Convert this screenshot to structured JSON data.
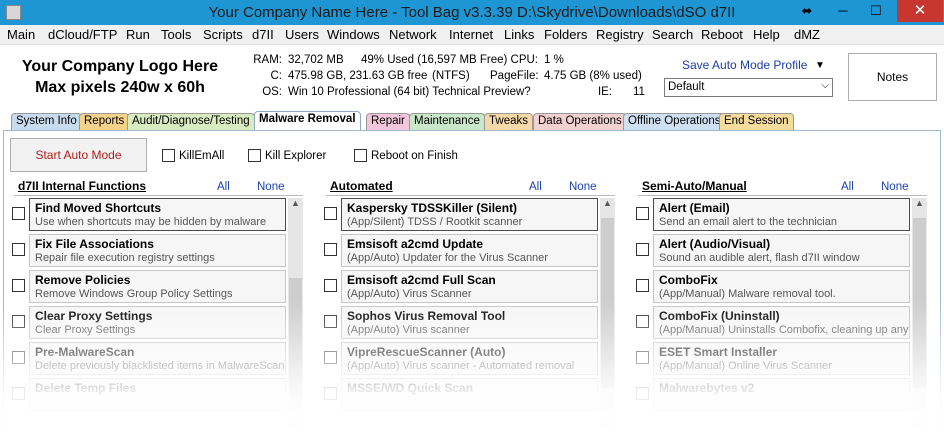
{
  "window": {
    "title": "Your Company Name Here - Tool Bag  v3.3.39  D:\\Skydrive\\Downloads\\dSO d7II",
    "minimize": "─",
    "maximize": "☐",
    "close": "✕",
    "resize": "⬌"
  },
  "menu": [
    "Main",
    "dCloud/FTP",
    "Run",
    "Tools",
    "Scripts",
    "d7II",
    "Users",
    "Windows",
    "Network",
    "Internet",
    "Links",
    "Folders",
    "Registry",
    "Search",
    "Reboot",
    "Help",
    "dMZ"
  ],
  "logo": {
    "line1": "Your Company Logo Here",
    "line2": "Max pixels 240w x 60h"
  },
  "sysinfo": {
    "ram_label": "RAM:",
    "ram_value": "32,702 MB",
    "ram_used": "49% Used (16,597 MB Free)",
    "cpu_label": "CPU:",
    "cpu_value": "1 %",
    "c_label": "C:",
    "c_value": "475.98 GB, 231.63 GB free",
    "c_fs": "(NTFS)",
    "pagefile_label": "PageFile:",
    "pagefile_value": "4.75 GB (8% used)",
    "os_label": "OS:",
    "os_value": "Win 10 Professional  (64 bit) Technical Preview?",
    "ie_label": "IE:",
    "ie_value": "11"
  },
  "profile": {
    "link": "Save Auto Mode Profile",
    "arrow": "▼",
    "selected": "Default",
    "dd": "⌵"
  },
  "notes_label": "Notes",
  "tabs": [
    {
      "label": "System Info",
      "color": "#c8dcf0"
    },
    {
      "label": "Reports",
      "color": "#f4d28a"
    },
    {
      "label": "Audit/Diagnose/Testing",
      "color": "#d8ecc0"
    },
    {
      "label": "Malware Removal",
      "color": "#ffffff"
    },
    {
      "label": "Repair",
      "color": "#f3c6dc"
    },
    {
      "label": "Maintenance",
      "color": "#c9e7c9"
    },
    {
      "label": "Tweaks",
      "color": "#f7d9a8"
    },
    {
      "label": "Data Operations",
      "color": "#f3d1d1"
    },
    {
      "label": "Offline Operations",
      "color": "#cfe0f2"
    },
    {
      "label": "End Session",
      "color": "#f6dc9c"
    }
  ],
  "controls": {
    "start_auto": "Start Auto Mode",
    "killemall": "KillEmAll",
    "kill_explorer": "Kill Explorer",
    "reboot_on_finish": "Reboot on Finish"
  },
  "columns": [
    {
      "heading": "d7II Internal Functions",
      "all": "All",
      "none": "None",
      "items": [
        {
          "title": "Find Moved Shortcuts",
          "desc": "Use when shortcuts may be hidden by malware"
        },
        {
          "title": "Fix File Associations",
          "desc": "Repair file execution registry settings"
        },
        {
          "title": "Remove Policies",
          "desc": "Remove Windows Group Policy Settings"
        },
        {
          "title": "Clear Proxy Settings",
          "desc": "Clear Proxy Settings"
        },
        {
          "title": "Pre-MalwareScan",
          "desc": "Delete previously blacklisted items in MalwareScan"
        },
        {
          "title": "Delete Temp Files",
          "desc": ""
        }
      ]
    },
    {
      "heading": "Automated",
      "all": "All",
      "none": "None",
      "items": [
        {
          "title": "Kaspersky TDSSKiller (Silent)",
          "desc": "(App/Silent) TDSS / Rootkit scanner"
        },
        {
          "title": "Emsisoft a2cmd Update",
          "desc": "(App/Auto) Updater for the Virus Scanner"
        },
        {
          "title": "Emsisoft a2cmd Full Scan",
          "desc": "(App/Auto) Virus Scanner"
        },
        {
          "title": "Sophos Virus Removal Tool",
          "desc": "(App/Auto) Virus scanner"
        },
        {
          "title": "VipreRescueScanner (Auto)",
          "desc": "(App/Auto) Virus scanner - Automated removal"
        },
        {
          "title": "MSSE/WD Quick Scan",
          "desc": ""
        }
      ]
    },
    {
      "heading": "Semi-Auto/Manual",
      "all": "All",
      "none": "None",
      "items": [
        {
          "title": "Alert (Email)",
          "desc": "Send an email alert to the technician"
        },
        {
          "title": "Alert (Audio/Visual)",
          "desc": "Sound an audible alert, flash d7II window"
        },
        {
          "title": "ComboFix",
          "desc": "(App/Manual) Malware removal tool."
        },
        {
          "title": "ComboFix (Uninstall)",
          "desc": "(App/Manual) Uninstalls Combofix, cleaning up any le"
        },
        {
          "title": "ESET Smart Installer",
          "desc": "(App/Manual) Online Virus Scanner"
        },
        {
          "title": "Malwarebytes v2",
          "desc": ""
        }
      ]
    }
  ]
}
